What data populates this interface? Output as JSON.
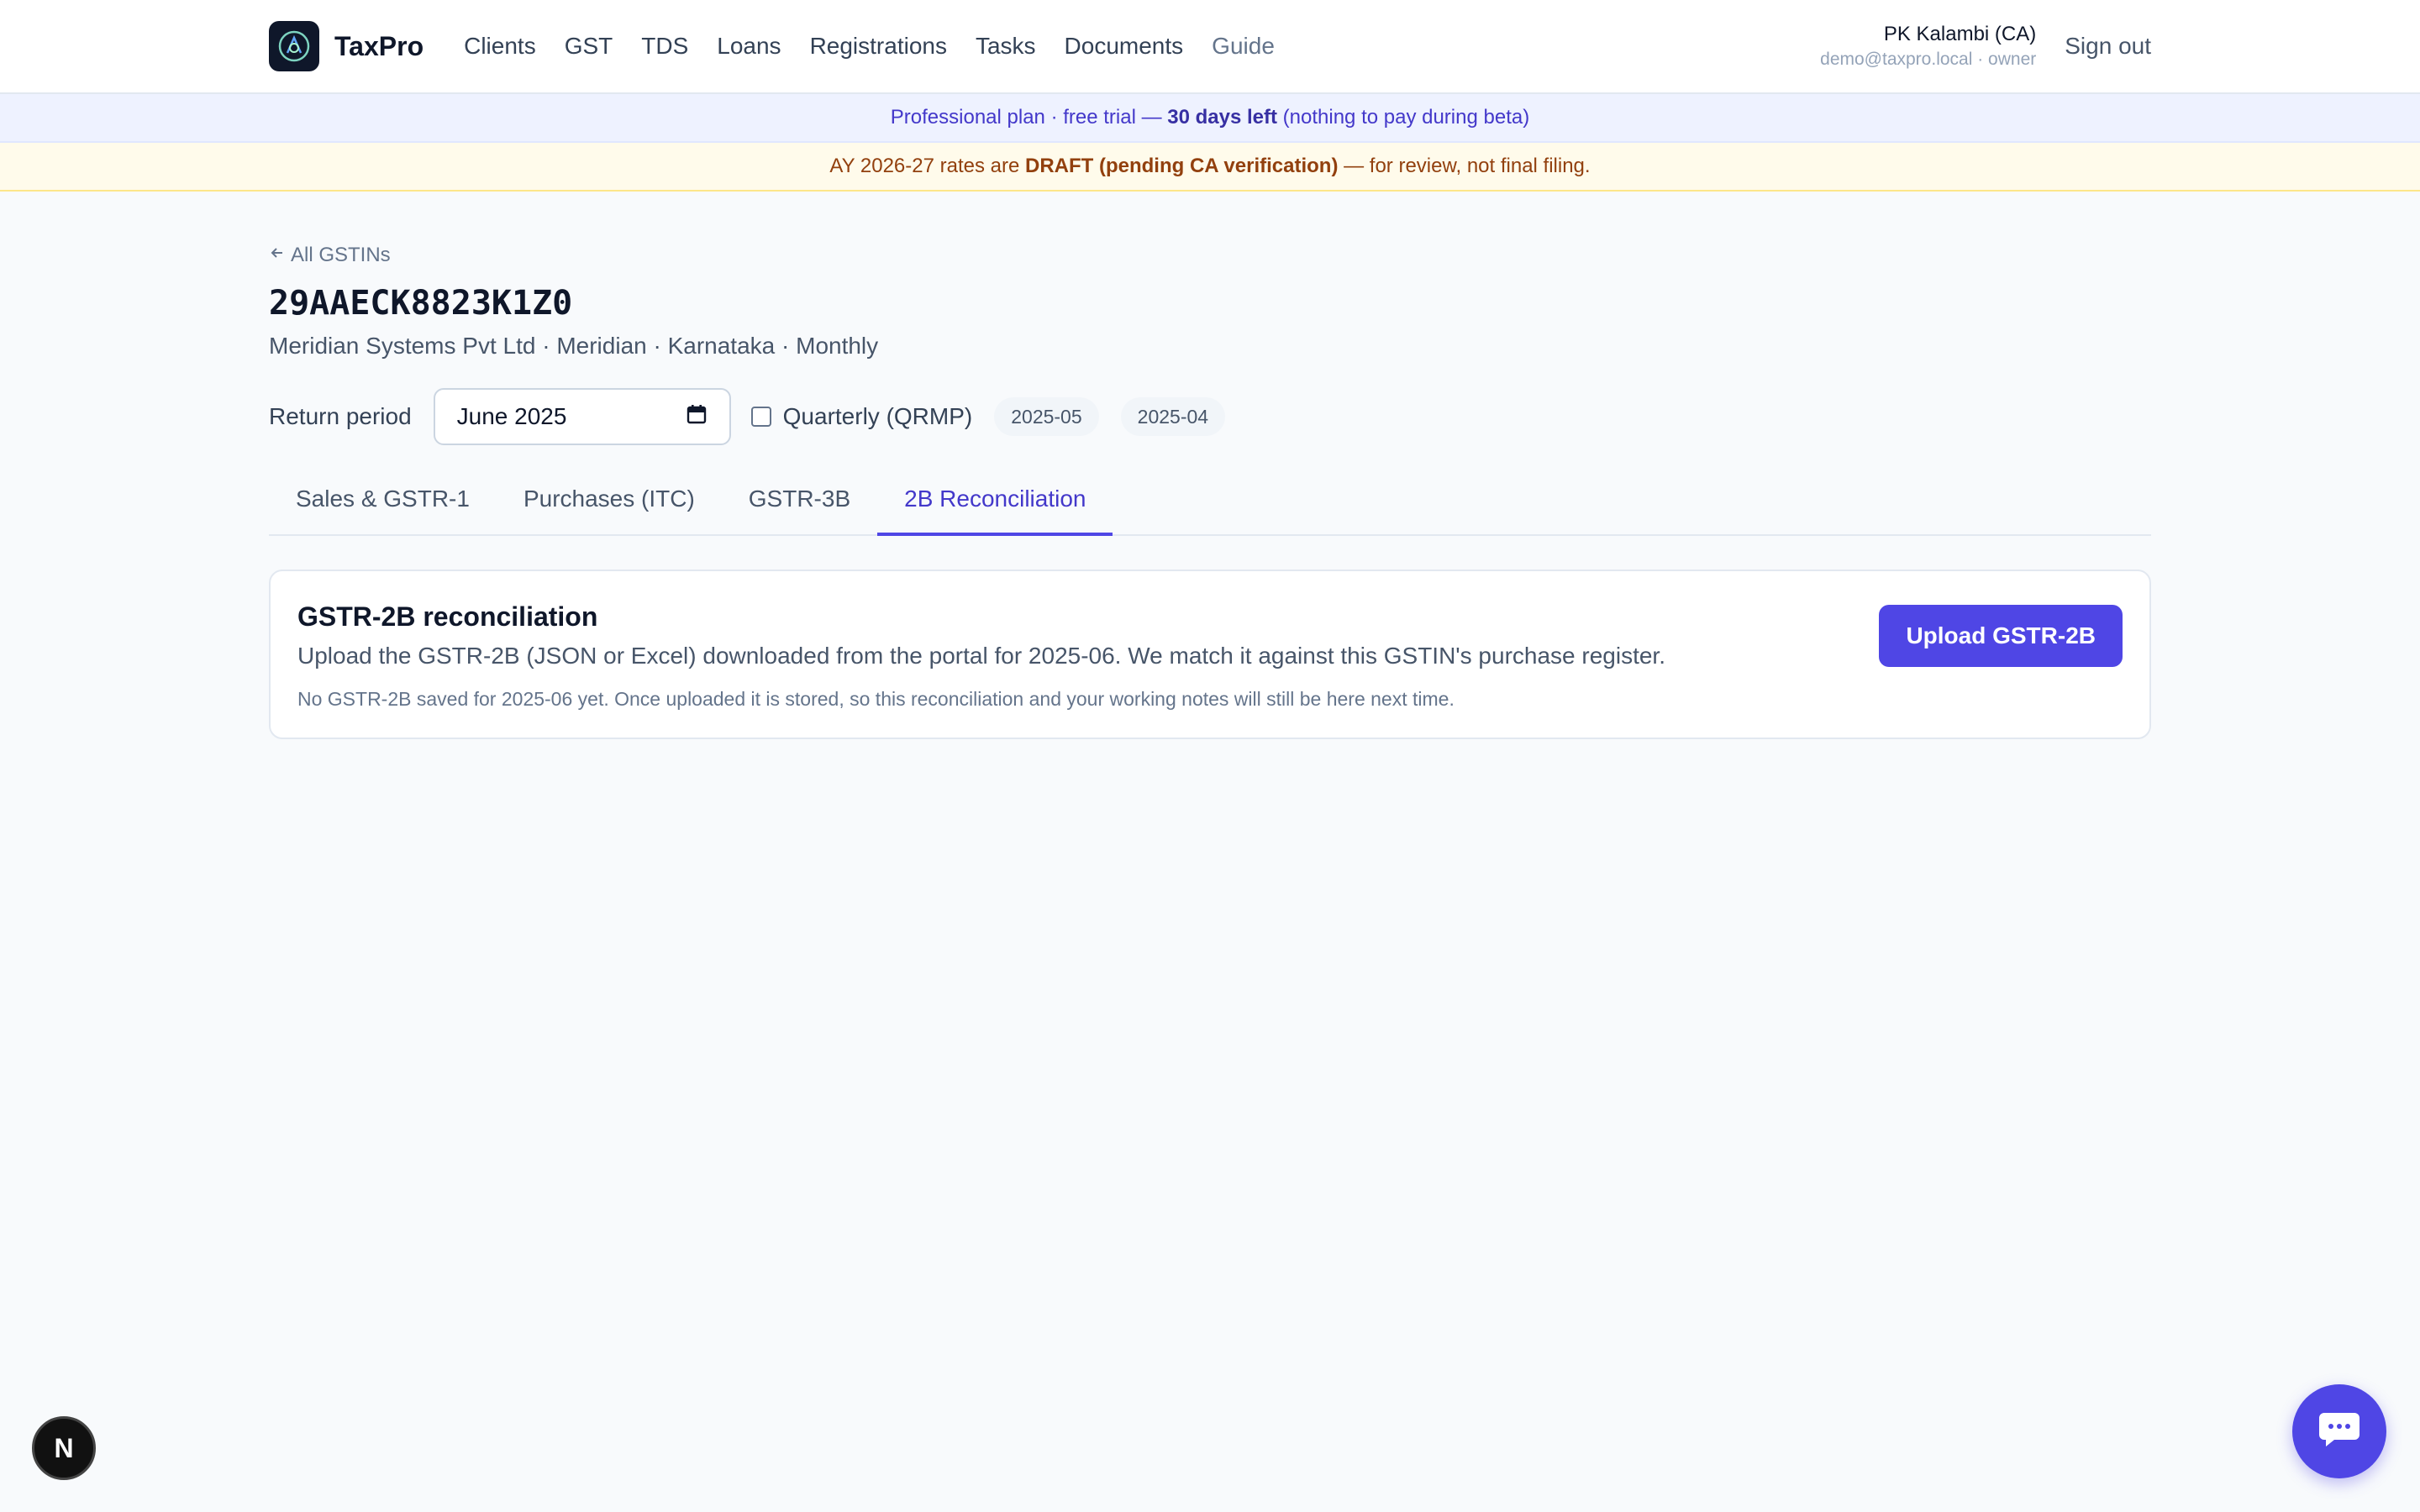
{
  "brand": {
    "name": "TaxPro",
    "logo_icon": "taxpro-logo-icon"
  },
  "nav": {
    "items": [
      {
        "label": "Clients"
      },
      {
        "label": "GST"
      },
      {
        "label": "TDS"
      },
      {
        "label": "Loans"
      },
      {
        "label": "Registrations"
      },
      {
        "label": "Tasks"
      },
      {
        "label": "Documents"
      },
      {
        "label": "Guide"
      }
    ]
  },
  "user": {
    "name": "PK Kalambi (CA)",
    "email_role": "demo@taxpro.local · owner",
    "signout_label": "Sign out"
  },
  "banners": {
    "plan_prefix": "Professional plan · free trial — ",
    "plan_highlight": "30 days left",
    "plan_suffix": " (nothing to pay during beta)",
    "draft_prefix": "AY 2026-27 rates are ",
    "draft_highlight": "DRAFT (pending CA verification)",
    "draft_suffix": " — for review, not final filing."
  },
  "page": {
    "back_label": "All GSTINs",
    "gstin": "29AAECK8823K1Z0",
    "subtitle": "Meridian Systems Pvt Ltd · Meridian · Karnataka · Monthly"
  },
  "period": {
    "label": "Return period",
    "value": "June 2025",
    "quarterly_label": "Quarterly (QRMP)",
    "quarterly_checked": false,
    "recent": [
      "2025-05",
      "2025-04"
    ]
  },
  "tabs": [
    {
      "label": "Sales & GSTR-1"
    },
    {
      "label": "Purchases (ITC)"
    },
    {
      "label": "GSTR-3B"
    },
    {
      "label": "2B Reconciliation",
      "active": true
    }
  ],
  "card": {
    "title": "GSTR-2B reconciliation",
    "description": "Upload the GSTR-2B (JSON or Excel) downloaded from the portal for 2025-06. We match it against this GSTIN's purchase register.",
    "note": "No GSTR-2B saved for 2025-06 yet. Once uploaded it is stored, so this reconciliation and your working notes will still be here next time.",
    "button_label": "Upload GSTR-2B"
  },
  "colors": {
    "accent": "#4f46e5",
    "plan_banner_bg": "#eef2ff",
    "draft_banner_bg": "#fffbeb"
  },
  "widgets": {
    "dev_badge_letter": "N",
    "chat_icon": "chat-bubble-icon"
  }
}
